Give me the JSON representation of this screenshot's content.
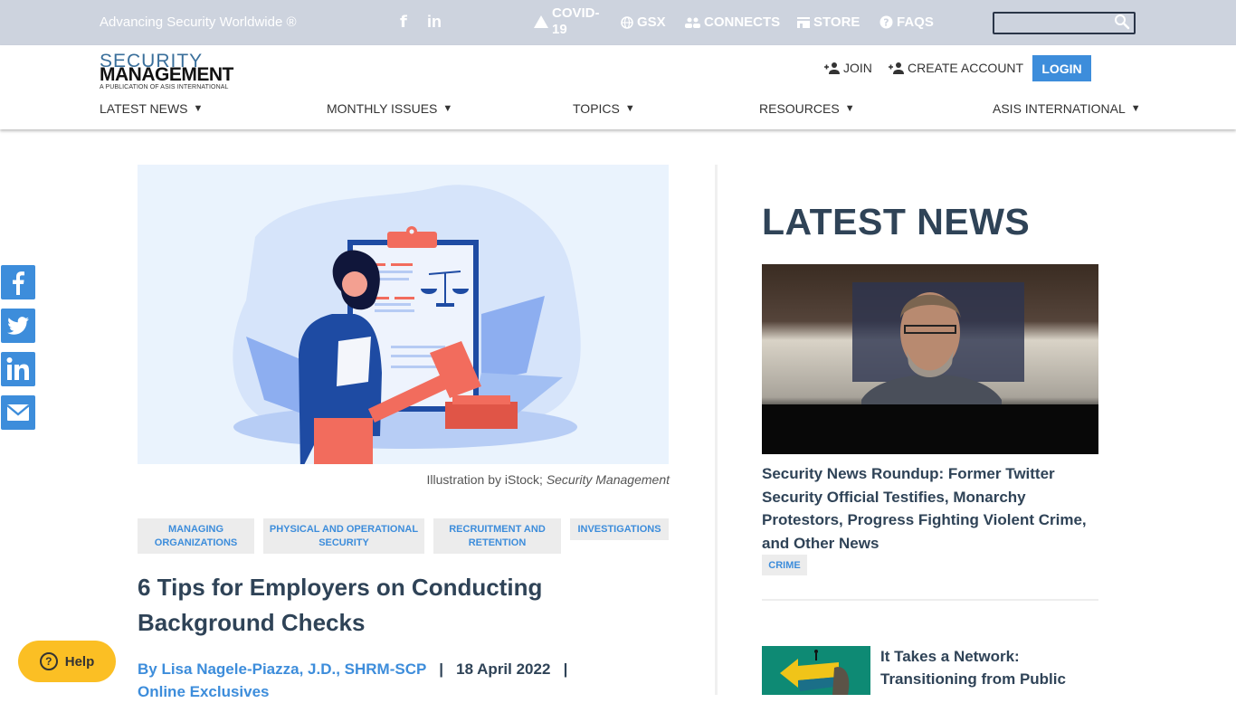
{
  "topbar": {
    "tagline": "Advancing Security Worldwide ®",
    "social": [
      {
        "icon": "facebook-icon",
        "glyph": "f"
      },
      {
        "icon": "linkedin-icon",
        "glyph": "in"
      }
    ],
    "links": [
      {
        "label": "COVID-19",
        "icon": "warning-icon"
      },
      {
        "label": "GSX",
        "icon": "globe-icon"
      },
      {
        "label": "CONNECTS",
        "icon": "people-icon"
      },
      {
        "label": "STORE",
        "icon": "store-icon"
      },
      {
        "label": "FAQS",
        "icon": "help-circle-icon"
      }
    ],
    "search": {
      "placeholder": "",
      "value": ""
    }
  },
  "header": {
    "logo": {
      "line1": "SECURITY",
      "line2": "MANAGEMENT",
      "line3": "A PUBLICATION OF ASIS INTERNATIONAL"
    },
    "account": {
      "join": "JOIN",
      "create": "CREATE ACCOUNT",
      "login": "LOGIN"
    },
    "nav": [
      {
        "label": "LATEST NEWS"
      },
      {
        "label": "MONTHLY ISSUES"
      },
      {
        "label": "TOPICS"
      },
      {
        "label": "RESOURCES"
      },
      {
        "label": "ASIS INTERNATIONAL"
      }
    ],
    "caret": "▼"
  },
  "share": [
    "facebook",
    "twitter",
    "linkedin",
    "email"
  ],
  "article": {
    "caption_plain": "Illustration by iStock; ",
    "caption_italic": "Security Management",
    "tags": [
      "MANAGING ORGANIZATIONS",
      "PHYSICAL AND OPERATIONAL SECURITY",
      "RECRUITMENT AND RETENTION",
      "INVESTIGATIONS"
    ],
    "title": "6 Tips for Employers on Conducting Background Checks",
    "author": "By Lisa Nagele-Piazza, J.D., SHRM-SCP",
    "separator": "|",
    "date": "18 April 2022",
    "section": "Online Exclusives"
  },
  "help": {
    "label": "Help",
    "glyph": "?"
  },
  "latest_news": {
    "heading": "LATEST NEWS",
    "items": [
      {
        "title": "Security News Roundup: Former Twitter Security Official Testifies, Monarchy Protestors, Progress Fighting Violent Crime, and Other News",
        "tag": "CRIME"
      },
      {
        "title": "It Takes a Network: Transitioning from Public"
      }
    ]
  },
  "colors": {
    "accent": "#3d8ddb",
    "heading": "#2f4357",
    "topbar": "#cdd3de",
    "help": "#fbbf24",
    "tag_bg": "#ececec"
  }
}
